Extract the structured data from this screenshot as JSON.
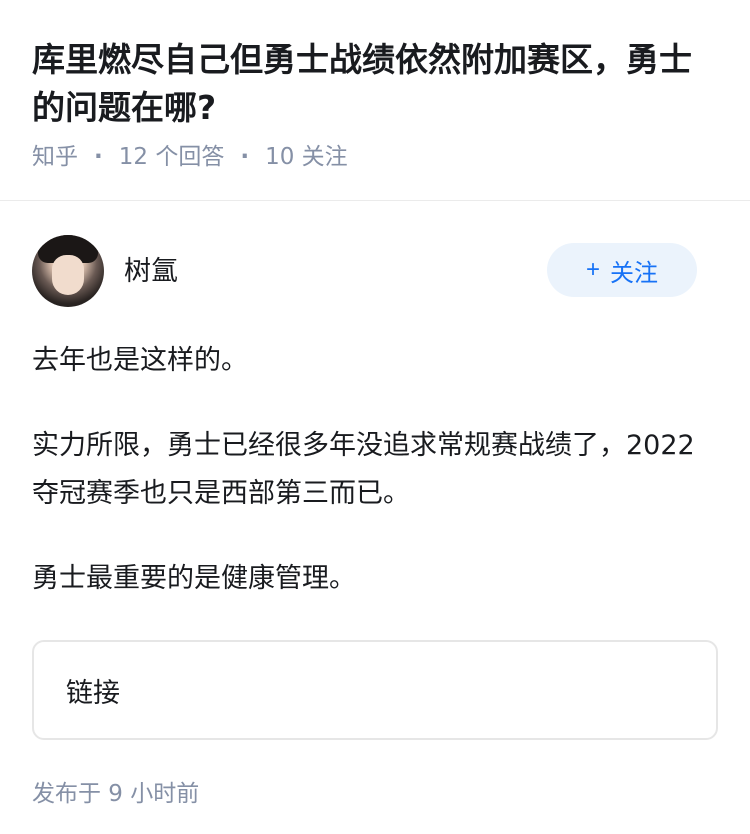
{
  "question": {
    "title": "库里燃尽自己但勇士战绩依然附加赛区，勇士的问题在哪?",
    "source": "知乎",
    "answers_count": "12 个回答",
    "followers_count": "10 关注"
  },
  "author": {
    "name": "树氲",
    "follow_plus": "+",
    "follow_label": "关注"
  },
  "answer": {
    "paragraphs": [
      "去年也是这样的。",
      "实力所限，勇士已经很多年没追求常规赛战绩了，2022夺冠赛季也只是西部第三而已。",
      "勇士最重要的是健康管理。"
    ],
    "link_label": "链接",
    "published": "发布于  9 小时前"
  },
  "colors": {
    "accent": "#1772f6",
    "follow_bg": "#ebf3fc",
    "meta": "#8590a6",
    "text": "#191b1f"
  }
}
